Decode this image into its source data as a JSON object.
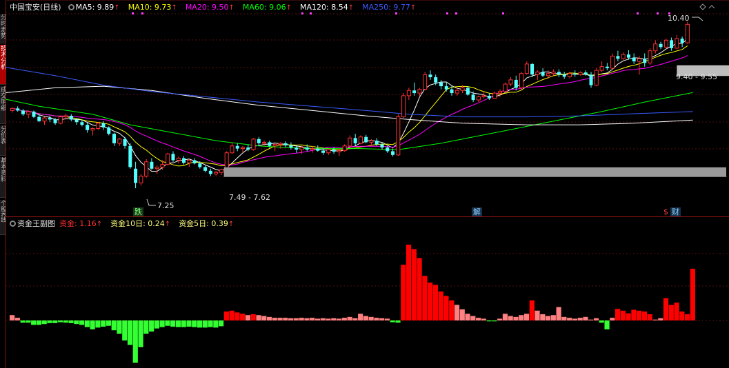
{
  "header": {
    "title": "中国宝安(日线)",
    "ma": [
      {
        "label": "MA5: 9.89",
        "color": "#ffffff"
      },
      {
        "label": "MA10: 9.73",
        "color": "#ffff00"
      },
      {
        "label": "MA20: 9.50",
        "color": "#ff00ff"
      },
      {
        "label": "MA60: 9.06",
        "color": "#00ff00"
      },
      {
        "label": "MA120: 8.54",
        "color": "#ffffff"
      },
      {
        "label": "MA250: 9.77",
        "color": "#3b5bff"
      }
    ]
  },
  "sub_header": {
    "title": "资金王副图",
    "items": [
      {
        "label": "资金: 1.16",
        "color": "#ff3030"
      },
      {
        "label": "资金10日: 0.24",
        "color": "#ffff80"
      },
      {
        "label": "资金5日: 0.39",
        "color": "#ffff80"
      }
    ]
  },
  "side_tabs": [
    {
      "label": "分时走势",
      "active": false
    },
    {
      "label": "技术分析",
      "active": true
    },
    {
      "label": "成交明细",
      "active": false
    },
    {
      "label": "分价表",
      "active": false
    },
    {
      "label": "基本资料",
      "active": false
    },
    {
      "label": "个股K线",
      "active": false
    }
  ],
  "annotations": {
    "high_label": "10.40",
    "low_label": "7.25",
    "range_low_label": "7.49 - 7.62",
    "range_high_label": "9.40 - 9.55"
  },
  "markers": {
    "die": "跌",
    "jie": "解",
    "cai": "财",
    "dollar": "$"
  },
  "colors": {
    "up": "#ff3232",
    "down": "#54ffff",
    "flow_pos_strong": "#ff0000",
    "flow_pos_weak": "#ff8080",
    "flow_neg": "#33ff33"
  },
  "chart_data": {
    "type": "candlestick",
    "price_range": [
      6.9,
      10.55
    ],
    "flow_range": [
      -1.1,
      2.0
    ],
    "ma_series": [
      {
        "name": "MA5",
        "color": "#ffffff"
      },
      {
        "name": "MA10",
        "color": "#ffff00"
      },
      {
        "name": "MA20",
        "color": "#ff00ff"
      },
      {
        "name": "MA60",
        "color": "#00ff00"
      },
      {
        "name": "MA120",
        "color": "#ffffff"
      },
      {
        "name": "MA250",
        "color": "#3b5bff"
      }
    ],
    "candles": [
      [
        8.72,
        8.78,
        8.68,
        8.76
      ],
      [
        8.76,
        8.8,
        8.7,
        8.72
      ],
      [
        8.72,
        8.75,
        8.62,
        8.65
      ],
      [
        8.65,
        8.72,
        8.58,
        8.7
      ],
      [
        8.7,
        8.72,
        8.58,
        8.6
      ],
      [
        8.6,
        8.65,
        8.5,
        8.52
      ],
      [
        8.52,
        8.6,
        8.45,
        8.58
      ],
      [
        8.58,
        8.62,
        8.5,
        8.55
      ],
      [
        8.55,
        8.58,
        8.45,
        8.48
      ],
      [
        8.48,
        8.62,
        8.46,
        8.6
      ],
      [
        8.6,
        8.66,
        8.55,
        8.62
      ],
      [
        8.62,
        8.65,
        8.52,
        8.55
      ],
      [
        8.55,
        8.58,
        8.45,
        8.5
      ],
      [
        8.5,
        8.55,
        8.42,
        8.45
      ],
      [
        8.45,
        8.5,
        8.3,
        8.35
      ],
      [
        8.35,
        8.4,
        8.25,
        8.38
      ],
      [
        8.38,
        8.5,
        8.35,
        8.48
      ],
      [
        8.48,
        8.52,
        8.35,
        8.4
      ],
      [
        8.4,
        8.42,
        8.25,
        8.28
      ],
      [
        8.28,
        8.3,
        8.05,
        8.1
      ],
      [
        8.1,
        8.2,
        8.05,
        8.18
      ],
      [
        8.18,
        8.22,
        8.0,
        8.05
      ],
      [
        8.05,
        8.1,
        7.62,
        7.65
      ],
      [
        7.62,
        7.75,
        7.25,
        7.35
      ],
      [
        7.35,
        7.52,
        7.3,
        7.48
      ],
      [
        7.48,
        7.8,
        7.45,
        7.75
      ],
      [
        7.75,
        7.82,
        7.6,
        7.62
      ],
      [
        7.62,
        7.68,
        7.52,
        7.65
      ],
      [
        7.65,
        7.78,
        7.6,
        7.7
      ],
      [
        7.7,
        7.92,
        7.68,
        7.9
      ],
      [
        7.9,
        7.95,
        7.75,
        7.78
      ],
      [
        7.78,
        7.85,
        7.72,
        7.82
      ],
      [
        7.82,
        7.86,
        7.7,
        7.73
      ],
      [
        7.73,
        7.8,
        7.65,
        7.78
      ],
      [
        7.78,
        7.82,
        7.7,
        7.72
      ],
      [
        7.72,
        7.76,
        7.62,
        7.65
      ],
      [
        7.65,
        7.68,
        7.55,
        7.58
      ],
      [
        7.58,
        7.62,
        7.48,
        7.52
      ],
      [
        7.52,
        7.58,
        7.49,
        7.55
      ],
      [
        7.55,
        7.62,
        7.5,
        7.6
      ],
      [
        7.6,
        7.95,
        7.58,
        7.92
      ],
      [
        7.92,
        8.12,
        7.9,
        8.05
      ],
      [
        8.05,
        8.1,
        7.95,
        8.0
      ],
      [
        8.0,
        8.05,
        7.92,
        8.02
      ],
      [
        8.02,
        8.08,
        7.95,
        7.98
      ],
      [
        7.98,
        8.2,
        7.96,
        8.18
      ],
      [
        8.18,
        8.22,
        8.05,
        8.1
      ],
      [
        8.1,
        8.15,
        8.05,
        8.12
      ],
      [
        8.12,
        8.15,
        8.02,
        8.05
      ],
      [
        8.05,
        8.1,
        7.95,
        8.08
      ],
      [
        8.08,
        8.12,
        8.0,
        8.1
      ],
      [
        8.1,
        8.14,
        8.02,
        8.06
      ],
      [
        8.06,
        8.12,
        7.98,
        8.02
      ],
      [
        8.02,
        8.06,
        7.92,
        7.98
      ],
      [
        7.98,
        8.05,
        7.9,
        8.02
      ],
      [
        8.02,
        8.08,
        7.95,
        7.98
      ],
      [
        7.98,
        8.05,
        7.92,
        8.0
      ],
      [
        8.0,
        8.06,
        7.94,
        7.96
      ],
      [
        7.96,
        8.02,
        7.88,
        7.92
      ],
      [
        7.92,
        8.0,
        7.88,
        7.98
      ],
      [
        7.98,
        8.02,
        7.9,
        7.94
      ],
      [
        7.94,
        8.0,
        7.86,
        7.96
      ],
      [
        7.96,
        8.08,
        7.94,
        8.05
      ],
      [
        8.05,
        8.25,
        8.02,
        8.2
      ],
      [
        8.2,
        8.28,
        8.05,
        8.1
      ],
      [
        8.1,
        8.25,
        8.08,
        8.22
      ],
      [
        8.22,
        8.26,
        8.1,
        8.12
      ],
      [
        8.12,
        8.18,
        8.05,
        8.15
      ],
      [
        8.15,
        8.2,
        8.05,
        8.08
      ],
      [
        8.08,
        8.12,
        7.98,
        8.02
      ],
      [
        8.02,
        8.05,
        7.92,
        7.95
      ],
      [
        7.95,
        8.0,
        7.85,
        7.88
      ],
      [
        7.88,
        8.65,
        7.86,
        8.6
      ],
      [
        8.6,
        9.05,
        8.58,
        9.0
      ],
      [
        9.0,
        9.15,
        8.92,
        9.1
      ],
      [
        9.1,
        9.25,
        9.0,
        9.05
      ],
      [
        9.05,
        9.15,
        8.98,
        9.12
      ],
      [
        9.12,
        9.45,
        9.1,
        9.4
      ],
      [
        9.4,
        9.48,
        9.3,
        9.35
      ],
      [
        9.35,
        9.4,
        9.2,
        9.25
      ],
      [
        9.25,
        9.3,
        9.12,
        9.18
      ],
      [
        9.18,
        9.25,
        9.08,
        9.12
      ],
      [
        9.12,
        9.18,
        9.0,
        9.05
      ],
      [
        9.05,
        9.15,
        9.0,
        9.1
      ],
      [
        9.1,
        9.2,
        9.05,
        9.15
      ],
      [
        9.15,
        9.18,
        9.0,
        9.02
      ],
      [
        9.02,
        9.08,
        8.88,
        8.92
      ],
      [
        8.92,
        9.0,
        8.88,
        8.98
      ],
      [
        8.98,
        9.06,
        8.95,
        9.0
      ],
      [
        9.0,
        9.05,
        8.92,
        8.95
      ],
      [
        8.95,
        9.08,
        8.94,
        9.05
      ],
      [
        9.05,
        9.12,
        8.98,
        9.08
      ],
      [
        9.08,
        9.25,
        9.05,
        9.22
      ],
      [
        9.22,
        9.35,
        9.18,
        9.3
      ],
      [
        9.3,
        9.38,
        9.1,
        9.15
      ],
      [
        9.15,
        9.45,
        9.12,
        9.42
      ],
      [
        9.42,
        9.65,
        9.4,
        9.6
      ],
      [
        9.6,
        9.62,
        9.35,
        9.4
      ],
      [
        9.4,
        9.48,
        9.3,
        9.45
      ],
      [
        9.45,
        9.52,
        9.35,
        9.38
      ],
      [
        9.38,
        9.48,
        9.32,
        9.42
      ],
      [
        9.42,
        9.5,
        9.38,
        9.45
      ],
      [
        9.45,
        9.5,
        9.35,
        9.4
      ],
      [
        9.4,
        9.45,
        9.32,
        9.36
      ],
      [
        9.36,
        9.45,
        9.33,
        9.42
      ],
      [
        9.42,
        9.48,
        9.36,
        9.4
      ],
      [
        9.4,
        9.46,
        9.38,
        9.44
      ],
      [
        9.44,
        9.48,
        9.38,
        9.4
      ],
      [
        9.4,
        9.45,
        9.15,
        9.2
      ],
      [
        9.2,
        9.52,
        9.18,
        9.48
      ],
      [
        9.48,
        9.65,
        9.45,
        9.55
      ],
      [
        9.55,
        9.62,
        9.48,
        9.52
      ],
      [
        9.52,
        9.8,
        9.5,
        9.75
      ],
      [
        9.75,
        9.85,
        9.65,
        9.7
      ],
      [
        9.7,
        9.82,
        9.68,
        9.78
      ],
      [
        9.78,
        9.86,
        9.68,
        9.72
      ],
      [
        9.72,
        9.8,
        9.6,
        9.65
      ],
      [
        9.65,
        9.75,
        9.4,
        9.7
      ],
      [
        9.7,
        9.8,
        9.55,
        9.62
      ],
      [
        9.62,
        9.9,
        9.58,
        9.85
      ],
      [
        9.85,
        10.05,
        9.8,
        9.98
      ],
      [
        9.98,
        10.02,
        9.88,
        9.92
      ],
      [
        9.92,
        10.08,
        9.9,
        10.05
      ],
      [
        10.05,
        10.1,
        9.85,
        9.9
      ],
      [
        9.9,
        10.15,
        9.88,
        10.08
      ],
      [
        10.08,
        10.12,
        9.92,
        10.0
      ],
      [
        10.0,
        10.4,
        9.98,
        10.35
      ]
    ],
    "flow": [
      0.12,
      0.06,
      -0.05,
      -0.05,
      -0.1,
      -0.1,
      -0.08,
      -0.06,
      -0.06,
      -0.04,
      -0.05,
      -0.06,
      -0.08,
      -0.1,
      -0.15,
      -0.2,
      -0.16,
      -0.14,
      -0.12,
      -0.22,
      -0.3,
      -0.45,
      -0.55,
      -0.95,
      -0.6,
      -0.3,
      -0.25,
      -0.18,
      -0.15,
      -0.12,
      -0.14,
      -0.15,
      -0.15,
      -0.14,
      -0.15,
      -0.16,
      -0.16,
      -0.15,
      -0.16,
      -0.13,
      0.2,
      0.22,
      0.18,
      0.15,
      0.12,
      0.14,
      0.12,
      0.1,
      0.08,
      0.06,
      0.06,
      0.06,
      0.05,
      0.05,
      0.06,
      0.05,
      0.06,
      0.04,
      0.05,
      0.04,
      0.05,
      0.04,
      0.06,
      0.08,
      0.05,
      0.15,
      0.1,
      0.08,
      0.06,
      0.05,
      0.04,
      -0.04,
      -0.05,
      1.25,
      1.7,
      1.6,
      1.4,
      1.0,
      0.85,
      0.8,
      0.65,
      0.55,
      0.45,
      0.35,
      0.25,
      0.15,
      0.1,
      0.06,
      0.04,
      -0.02,
      -0.02,
      0.04,
      0.15,
      0.1,
      0.08,
      0.12,
      0.15,
      0.45,
      0.22,
      0.14,
      0.1,
      0.12,
      0.3,
      0.08,
      0.06,
      0.04,
      0.06,
      0.08,
      0.02,
      0.05,
      -0.05,
      -0.2,
      0.06,
      0.26,
      0.22,
      0.16,
      0.24,
      0.22,
      0.2,
      0.14,
      0.02,
      0.05,
      0.5,
      0.35,
      0.4,
      0.2,
      0.14,
      1.16
    ]
  }
}
